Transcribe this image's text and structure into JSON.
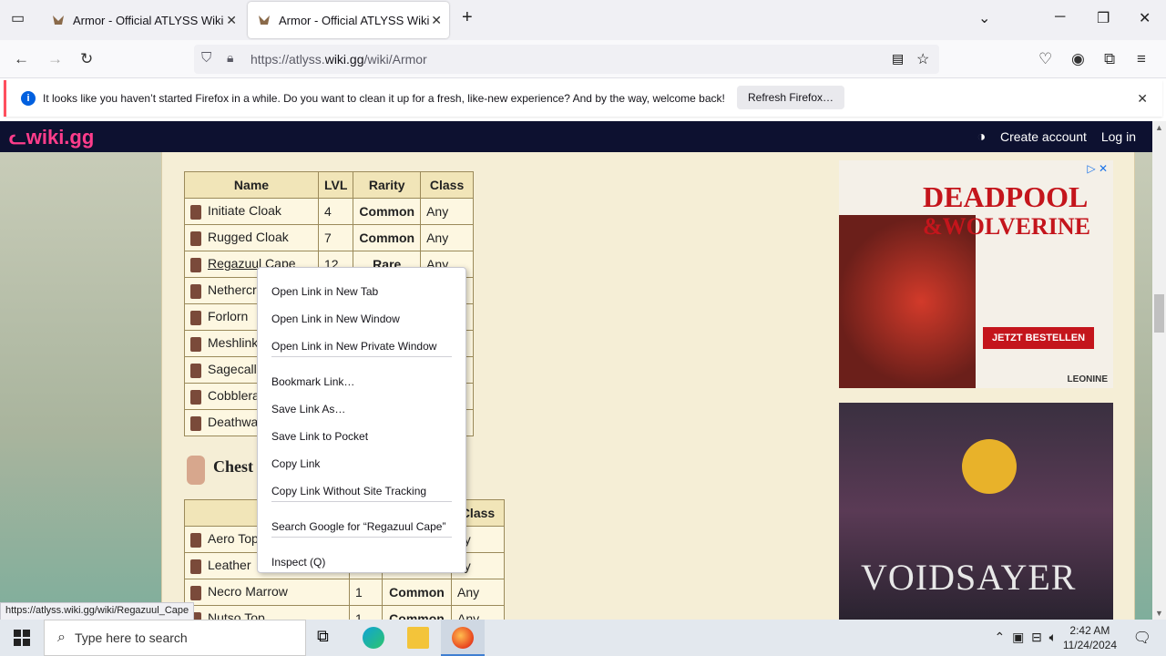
{
  "browser": {
    "tabs": [
      {
        "title": "Armor - Official ATLYSS Wiki",
        "active": false
      },
      {
        "title": "Armor - Official ATLYSS Wiki",
        "active": true
      }
    ],
    "new_tab_symbol": "+",
    "url_host_pre": "https://atlyss.",
    "url_host_bold": "wiki.gg",
    "url_path": "/wiki/Armor",
    "info_message": "It looks like you haven’t started Firefox in a while. Do you want to clean it up for a fresh, like-new experience? And by the way, welcome back!",
    "info_icon": "i",
    "refresh_label": "Refresh Firefox…",
    "status_url": "https://atlyss.wiki.gg/wiki/Regazuul_Cape"
  },
  "wiki": {
    "logo": "wiki.gg",
    "create_account": "Create account",
    "log_in": "Log in"
  },
  "capes_table": {
    "headers": [
      "Name",
      "LVL",
      "Rarity",
      "Class"
    ],
    "rows": [
      {
        "name": "Initiate Cloak",
        "lvl": "4",
        "rarity": "Common",
        "cls": "Any"
      },
      {
        "name": "Rugged Cloak",
        "lvl": "7",
        "rarity": "Common",
        "cls": "Any"
      },
      {
        "name": "Regazuul Cape",
        "lvl": "12",
        "rarity": "Rare",
        "cls": "Any"
      },
      {
        "name": "Nethercr",
        "lvl": "",
        "rarity": "",
        "cls": ""
      },
      {
        "name": "Forlorn",
        "lvl": "",
        "rarity": "",
        "cls": ""
      },
      {
        "name": "Meshlink",
        "lvl": "",
        "rarity": "",
        "cls": ""
      },
      {
        "name": "Sagecall",
        "lvl": "",
        "rarity": "",
        "cls": ""
      },
      {
        "name": "Cobblera",
        "lvl": "",
        "rarity": "",
        "cls": ""
      },
      {
        "name": "Deathwa",
        "lvl": "",
        "rarity": "",
        "cls": ""
      }
    ]
  },
  "chest": {
    "heading": "Chest",
    "headers": [
      "N",
      "",
      "",
      "Class"
    ],
    "rows": [
      {
        "name": "Aero Top",
        "lvl": "",
        "rarity": "",
        "cls": "ny"
      },
      {
        "name": "Leather",
        "lvl": "",
        "rarity": "",
        "cls": "ny"
      },
      {
        "name": "Necro Marrow",
        "lvl": "1",
        "rarity": "Common",
        "cls": "Any"
      },
      {
        "name": "Nutso Top",
        "lvl": "1",
        "rarity": "Common",
        "cls": "Any"
      }
    ]
  },
  "ads": {
    "ad1_title1": "DEADPOOL",
    "ad1_title2": "&WOLVERINE",
    "ad1_cta": "JETZT BESTELLEN",
    "ad1_brand": "LEONINE",
    "ad2_title": "VOIDSAYER"
  },
  "context_menu": [
    "Open Link in New Tab",
    "Open Link in New Window",
    "Open Link in New Private Window",
    "Bookmark Link…",
    "Save Link As…",
    "Save Link to Pocket",
    "Copy Link",
    "Copy Link Without Site Tracking",
    "Search Google for “Regazuul Cape”",
    "Inspect (Q)"
  ],
  "taskbar": {
    "search_placeholder": "Type here to search",
    "time": "2:42 AM",
    "date": "11/24/2024"
  },
  "colors": {
    "wiki_header": "#0d1130",
    "logo": "#ff3d8b",
    "link": "#3366cc",
    "rare": "#36b4e0"
  }
}
